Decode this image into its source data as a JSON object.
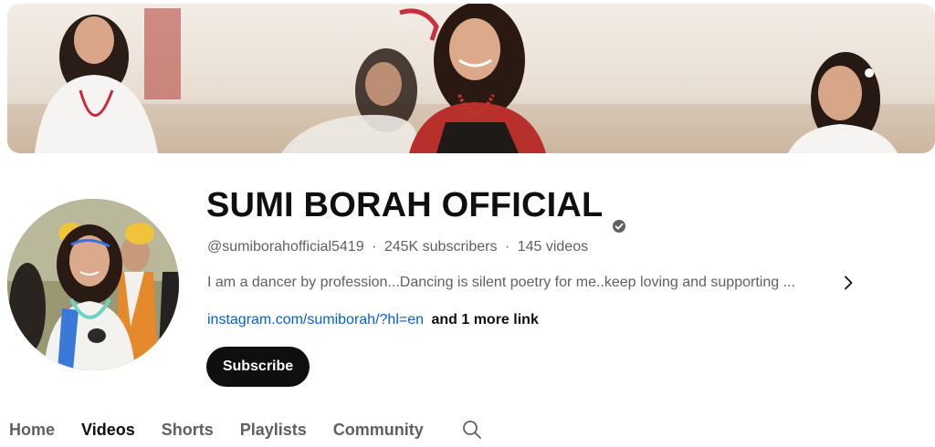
{
  "channel": {
    "name": "SUMI BORAH OFFICIAL",
    "verified": true,
    "handle": "@sumiborahofficial5419",
    "separator": "·",
    "subscribers": "245K subscribers",
    "videos": "145 videos",
    "description": "I am a dancer by profession...Dancing is silent poetry for me..keep loving and supporting ...",
    "link": "instagram.com/sumiborah/?hl=en",
    "more_links": "and 1 more link"
  },
  "subscribe": {
    "label": "Subscribe"
  },
  "tabs": [
    {
      "label": "Home",
      "active": false
    },
    {
      "label": "Videos",
      "active": true
    },
    {
      "label": "Shorts",
      "active": false
    },
    {
      "label": "Playlists",
      "active": false
    },
    {
      "label": "Community",
      "active": false
    }
  ],
  "icons": {
    "verified": "verified-check-icon",
    "description_more": "chevron-right-icon",
    "tab_search": "search-icon"
  },
  "colors": {
    "link": "#065fd4",
    "subscribe_bg": "#0f0f0f",
    "secondary_text": "#606060",
    "primary_text": "#0f0f0f"
  }
}
